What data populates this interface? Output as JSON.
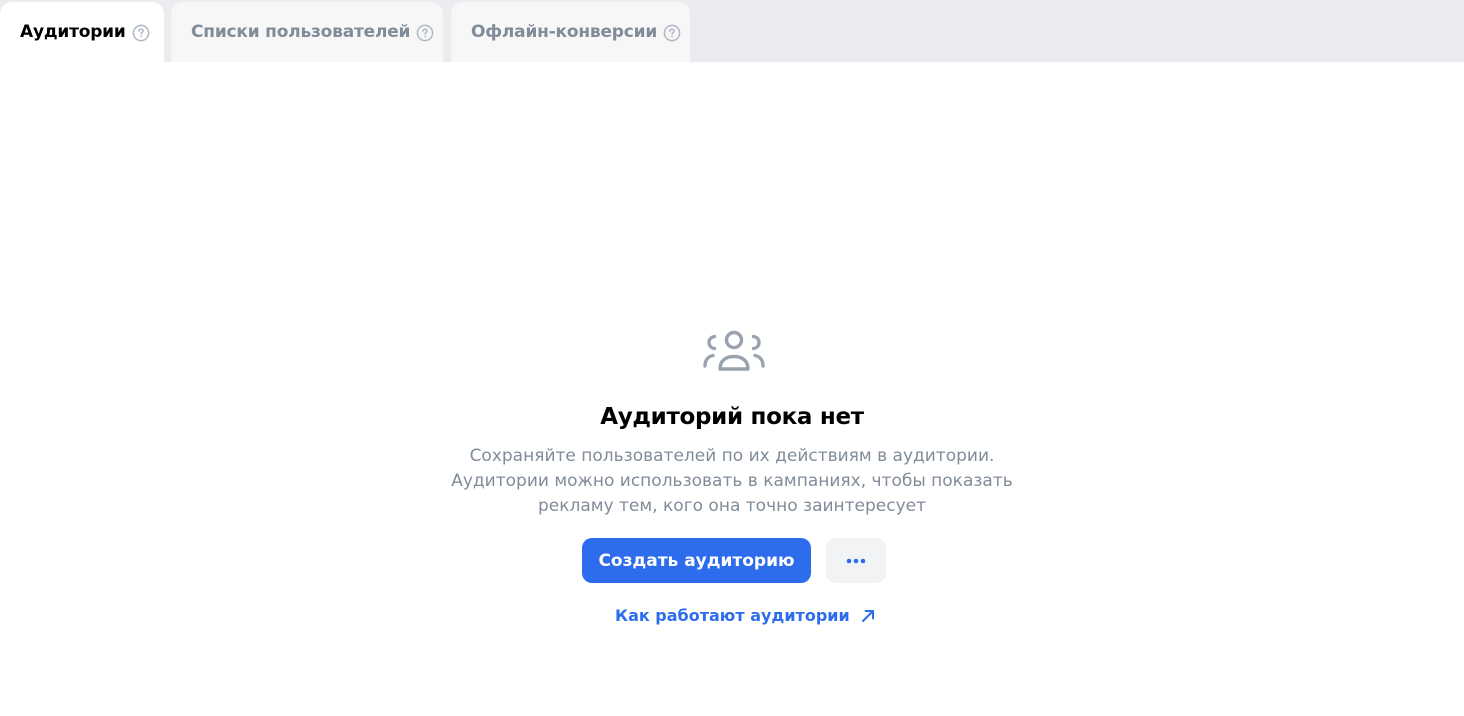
{
  "tabs": [
    {
      "label": "Аудитории",
      "active": true,
      "icon": "help-circle-icon"
    },
    {
      "label": "Списки пользователей",
      "active": false,
      "icon": "help-circle-icon"
    },
    {
      "label": "Офлайн-конверсии",
      "active": false,
      "icon": "help-circle-icon"
    }
  ],
  "empty_state": {
    "icon": "people-icon",
    "title": "Аудиторий пока нет",
    "description_lines": [
      "Сохраняйте пользователей по их действиям в аудитории.",
      "Аудитории можно использовать в кампаниях, чтобы показать",
      "рекламу тем, кого она точно заинтересует"
    ],
    "create_button_label": "Создать аудиторию",
    "more_button_icon": "ellipsis-icon",
    "help_link_label": "Как работают аудитории",
    "help_link_icon": "external-arrow-icon"
  },
  "colors": {
    "accent": "#2d6cec",
    "tabbar_bg": "#ebecef",
    "inactive_tab_bg": "#f7f7f8",
    "muted_text": "#818c99",
    "icon_gray": "#99a2ad"
  }
}
